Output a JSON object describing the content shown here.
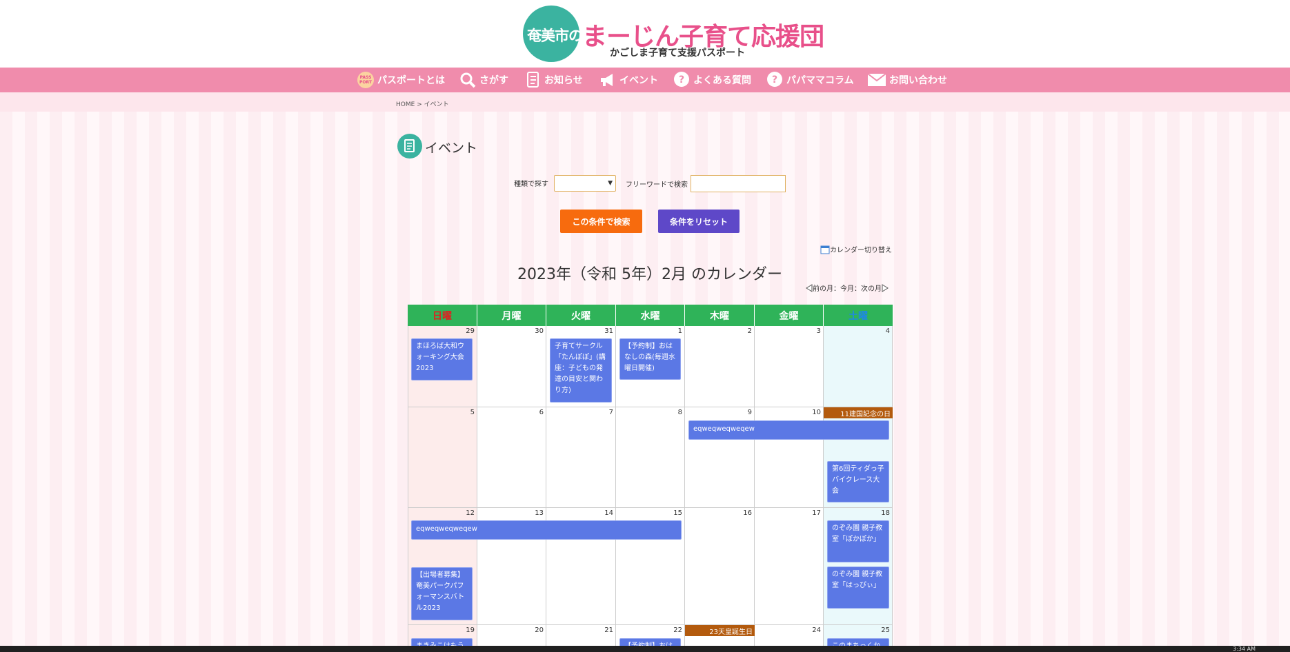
{
  "logo": {
    "city": "奄美市の",
    "main_a": "まーじん",
    "main_b": "子育て応援団",
    "sub": "かごしま子育て支援パスポート"
  },
  "nav": {
    "items": [
      {
        "label": "パスポートとは",
        "icon": "passport-icon"
      },
      {
        "label": "さがす",
        "icon": "magnifier-icon"
      },
      {
        "label": "お知らせ",
        "icon": "notice-icon"
      },
      {
        "label": "イベント",
        "icon": "megaphone-icon"
      },
      {
        "label": "よくある質問",
        "icon": "question-icon"
      },
      {
        "label": "パパママコラム",
        "icon": "question-icon"
      },
      {
        "label": "お問い合わせ",
        "icon": "mail-icon"
      }
    ],
    "active": "イベント"
  },
  "breadcrumb": {
    "home": "HOME",
    "sep": ">",
    "current": "イベント"
  },
  "page": {
    "title": "イベント"
  },
  "filters": {
    "type_label": "種類で探す",
    "type_value": "",
    "keyword_label": "フリーワードで検索",
    "keyword_value": ""
  },
  "buttons": {
    "search": "この条件で検索",
    "reset": "条件をリセット"
  },
  "calendar": {
    "switch_label": "カレンダー切り替え",
    "title": "2023年（令和 5年）2月 のカレンダー",
    "prev": "前の月",
    "current": "今月",
    "next": "次の月",
    "sep": "：",
    "weekdays": [
      "日曜",
      "月曜",
      "火曜",
      "水曜",
      "木曜",
      "金曜",
      "土曜"
    ],
    "weeks": [
      [
        "29",
        "30",
        "31",
        "1",
        "2",
        "3",
        "4"
      ],
      [
        "5",
        "6",
        "7",
        "8",
        "9",
        "10",
        ""
      ],
      [
        "12",
        "13",
        "14",
        "15",
        "16",
        "17",
        "18"
      ],
      [
        "19",
        "20",
        "21",
        "22",
        "",
        "24",
        "25"
      ]
    ],
    "holidays": {
      "feb11": "11建国記念の日",
      "feb23": "23天皇誕生日"
    },
    "events": {
      "w1_sun": "まほろば大和ウォーキング大会2023",
      "w1_tue": "子育てサークル「たんぽぽ」(講座：子どもの発達の目安と関わり方)",
      "w1_wed": "【予約制】おはなしの森(毎週水曜日開催)",
      "w2_span": "eqweqweqweqew",
      "w2_sat": "第6回ティダっ子バイクレース大会",
      "w3_span": "eqweqweqweqew",
      "w3_sun": "【出場者募集】奄美パークパフォーマンスバトル2023",
      "w3_sat1": "のぞみ園 親子教室「ぽかぽか」",
      "w3_sat2": "のぞみ園 親子教室「はっぴぃ」",
      "w4_sun": "まきみこけもう",
      "w4_wed": "【予約制】おは",
      "w4_sat": "このまちっくか"
    }
  },
  "taskbar": {
    "time": "3:34 AM"
  },
  "colors": {
    "nav": "#f08cac",
    "weekday_header": "#2fb359",
    "event": "#5b78e5",
    "search_button": "#f76b0e",
    "reset_button": "#5e48c8",
    "holiday": "#b35a0d",
    "logo_teal": "#3bb3a0"
  }
}
